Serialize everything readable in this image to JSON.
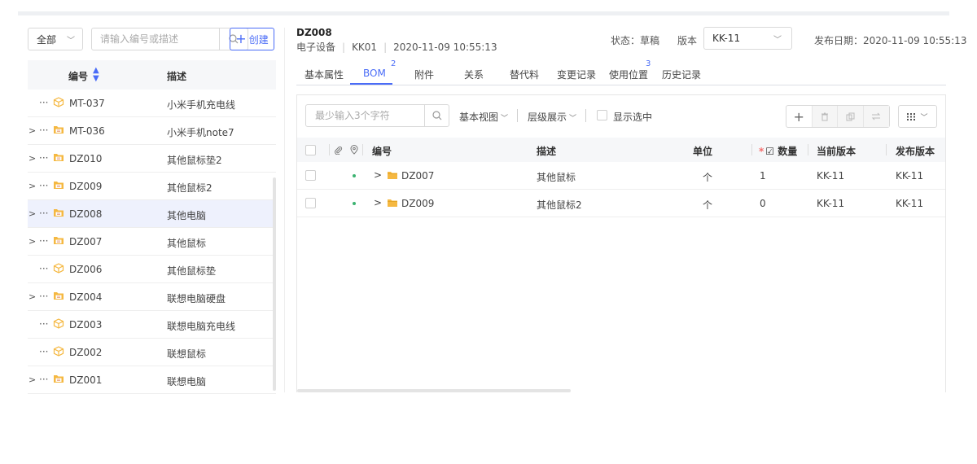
{
  "left_panel": {
    "filter_select": "全部",
    "search_placeholder": "请输入编号或描述",
    "create_button": "创建",
    "columns": {
      "code": "编号",
      "desc": "描述"
    },
    "rows": [
      {
        "expand": "",
        "icon": "cube-icon",
        "code": "MT-037",
        "desc": "小米手机充电线"
      },
      {
        "expand": ">",
        "icon": "folder-doc-icon",
        "code": "MT-036",
        "desc": "小米手机note7"
      },
      {
        "expand": ">",
        "icon": "folder-doc-icon",
        "code": "DZ010",
        "desc": "其他鼠标垫2"
      },
      {
        "expand": ">",
        "icon": "folder-doc-icon",
        "code": "DZ009",
        "desc": "其他鼠标2"
      },
      {
        "expand": ">",
        "icon": "folder-doc-icon",
        "code": "DZ008",
        "desc": "其他电脑",
        "selected": true
      },
      {
        "expand": ">",
        "icon": "folder-doc-icon",
        "code": "DZ007",
        "desc": "其他鼠标"
      },
      {
        "expand": "",
        "icon": "cube-icon",
        "code": "DZ006",
        "desc": "其他鼠标垫"
      },
      {
        "expand": ">",
        "icon": "folder-doc-icon",
        "code": "DZ004",
        "desc": "联想电脑硬盘"
      },
      {
        "expand": "",
        "icon": "cube-icon",
        "code": "DZ003",
        "desc": "联想电脑充电线"
      },
      {
        "expand": "",
        "icon": "cube-icon",
        "code": "DZ002",
        "desc": "联想鼠标"
      },
      {
        "expand": ">",
        "icon": "folder-doc-icon",
        "code": "DZ001",
        "desc": "联想电脑"
      }
    ]
  },
  "detail": {
    "title": "DZ008",
    "category": "电子设备",
    "code": "KK01",
    "date": "2020-11-09 10:55:13",
    "status": "状态：草稿",
    "version_label": "版本",
    "version_value": "KK-11",
    "publish_date": "发布日期：2020-11-09 10:55:13",
    "tabs": [
      {
        "label": "基本属性",
        "badge": ""
      },
      {
        "label": "BOM",
        "badge": "2",
        "active": true
      },
      {
        "label": "附件",
        "badge": ""
      },
      {
        "label": "关系",
        "badge": ""
      },
      {
        "label": "替代料",
        "badge": ""
      },
      {
        "label": "变更记录",
        "badge": ""
      },
      {
        "label": "使用位置",
        "badge": "3"
      },
      {
        "label": "历史记录",
        "badge": ""
      }
    ]
  },
  "bom": {
    "search_placeholder": "最少输入3个字符",
    "view_dropdown": "基本视图",
    "level_dropdown": "层级展示",
    "show_selected": "显示选中",
    "columns": {
      "code": "编号",
      "desc": "描述",
      "unit": "单位",
      "qty": "数量",
      "current_version": "当前版本",
      "release_version": "发布版本"
    },
    "rows": [
      {
        "code": "DZ007",
        "desc": "其他鼠标",
        "unit": "个",
        "qty": "1",
        "current_version": "KK-11",
        "release_version": "KK-11"
      },
      {
        "code": "DZ009",
        "desc": "其他鼠标2",
        "unit": "个",
        "qty": "0",
        "current_version": "KK-11",
        "release_version": "KK-11"
      }
    ]
  },
  "colors": {
    "accent": "#4a6cf7",
    "selected_row": "#eef1fd",
    "folder": "#f5b841",
    "required": "#f56c6c",
    "status_dot": "#3cb371"
  }
}
